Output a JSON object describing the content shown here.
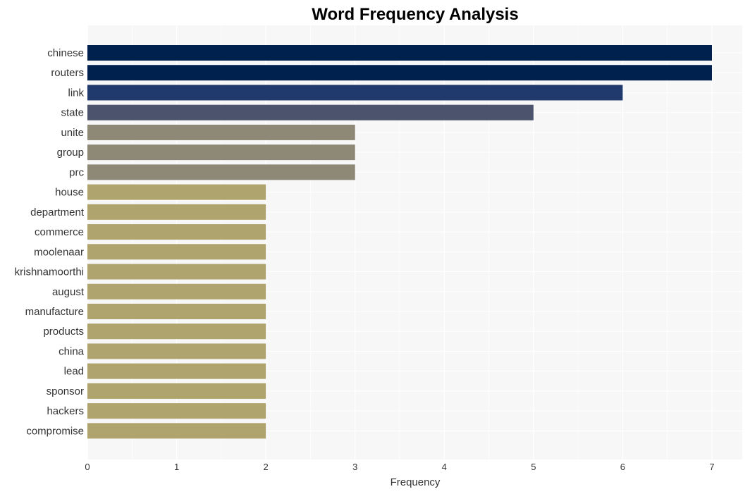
{
  "chart_data": {
    "type": "bar",
    "orientation": "horizontal",
    "title": "Word Frequency Analysis",
    "xlabel": "Frequency",
    "ylabel": "",
    "xlim": [
      0,
      7.3
    ],
    "xticks": [
      0,
      1,
      2,
      3,
      4,
      5,
      6,
      7
    ],
    "grid": true,
    "legend": "none",
    "categories": [
      "chinese",
      "routers",
      "link",
      "state",
      "unite",
      "group",
      "prc",
      "house",
      "department",
      "commerce",
      "moolenaar",
      "krishnamoorthi",
      "august",
      "manufacture",
      "products",
      "china",
      "lead",
      "sponsor",
      "hackers",
      "compromise"
    ],
    "values": [
      7,
      7,
      6,
      5,
      3,
      3,
      3,
      2,
      2,
      2,
      2,
      2,
      2,
      2,
      2,
      2,
      2,
      2,
      2,
      2
    ],
    "colors": [
      "#00214d",
      "#00214d",
      "#213a6e",
      "#4b546c",
      "#8e8877",
      "#8e8877",
      "#8e8877",
      "#b0a46e",
      "#b0a46e",
      "#b0a46e",
      "#b0a46e",
      "#b0a46e",
      "#b0a46e",
      "#b0a46e",
      "#b0a46e",
      "#b0a46e",
      "#b0a46e",
      "#b0a46e",
      "#b0a46e",
      "#b0a46e"
    ]
  },
  "style": {
    "plot_background": "#f7f7f7",
    "grid_color": "#ffffff"
  }
}
